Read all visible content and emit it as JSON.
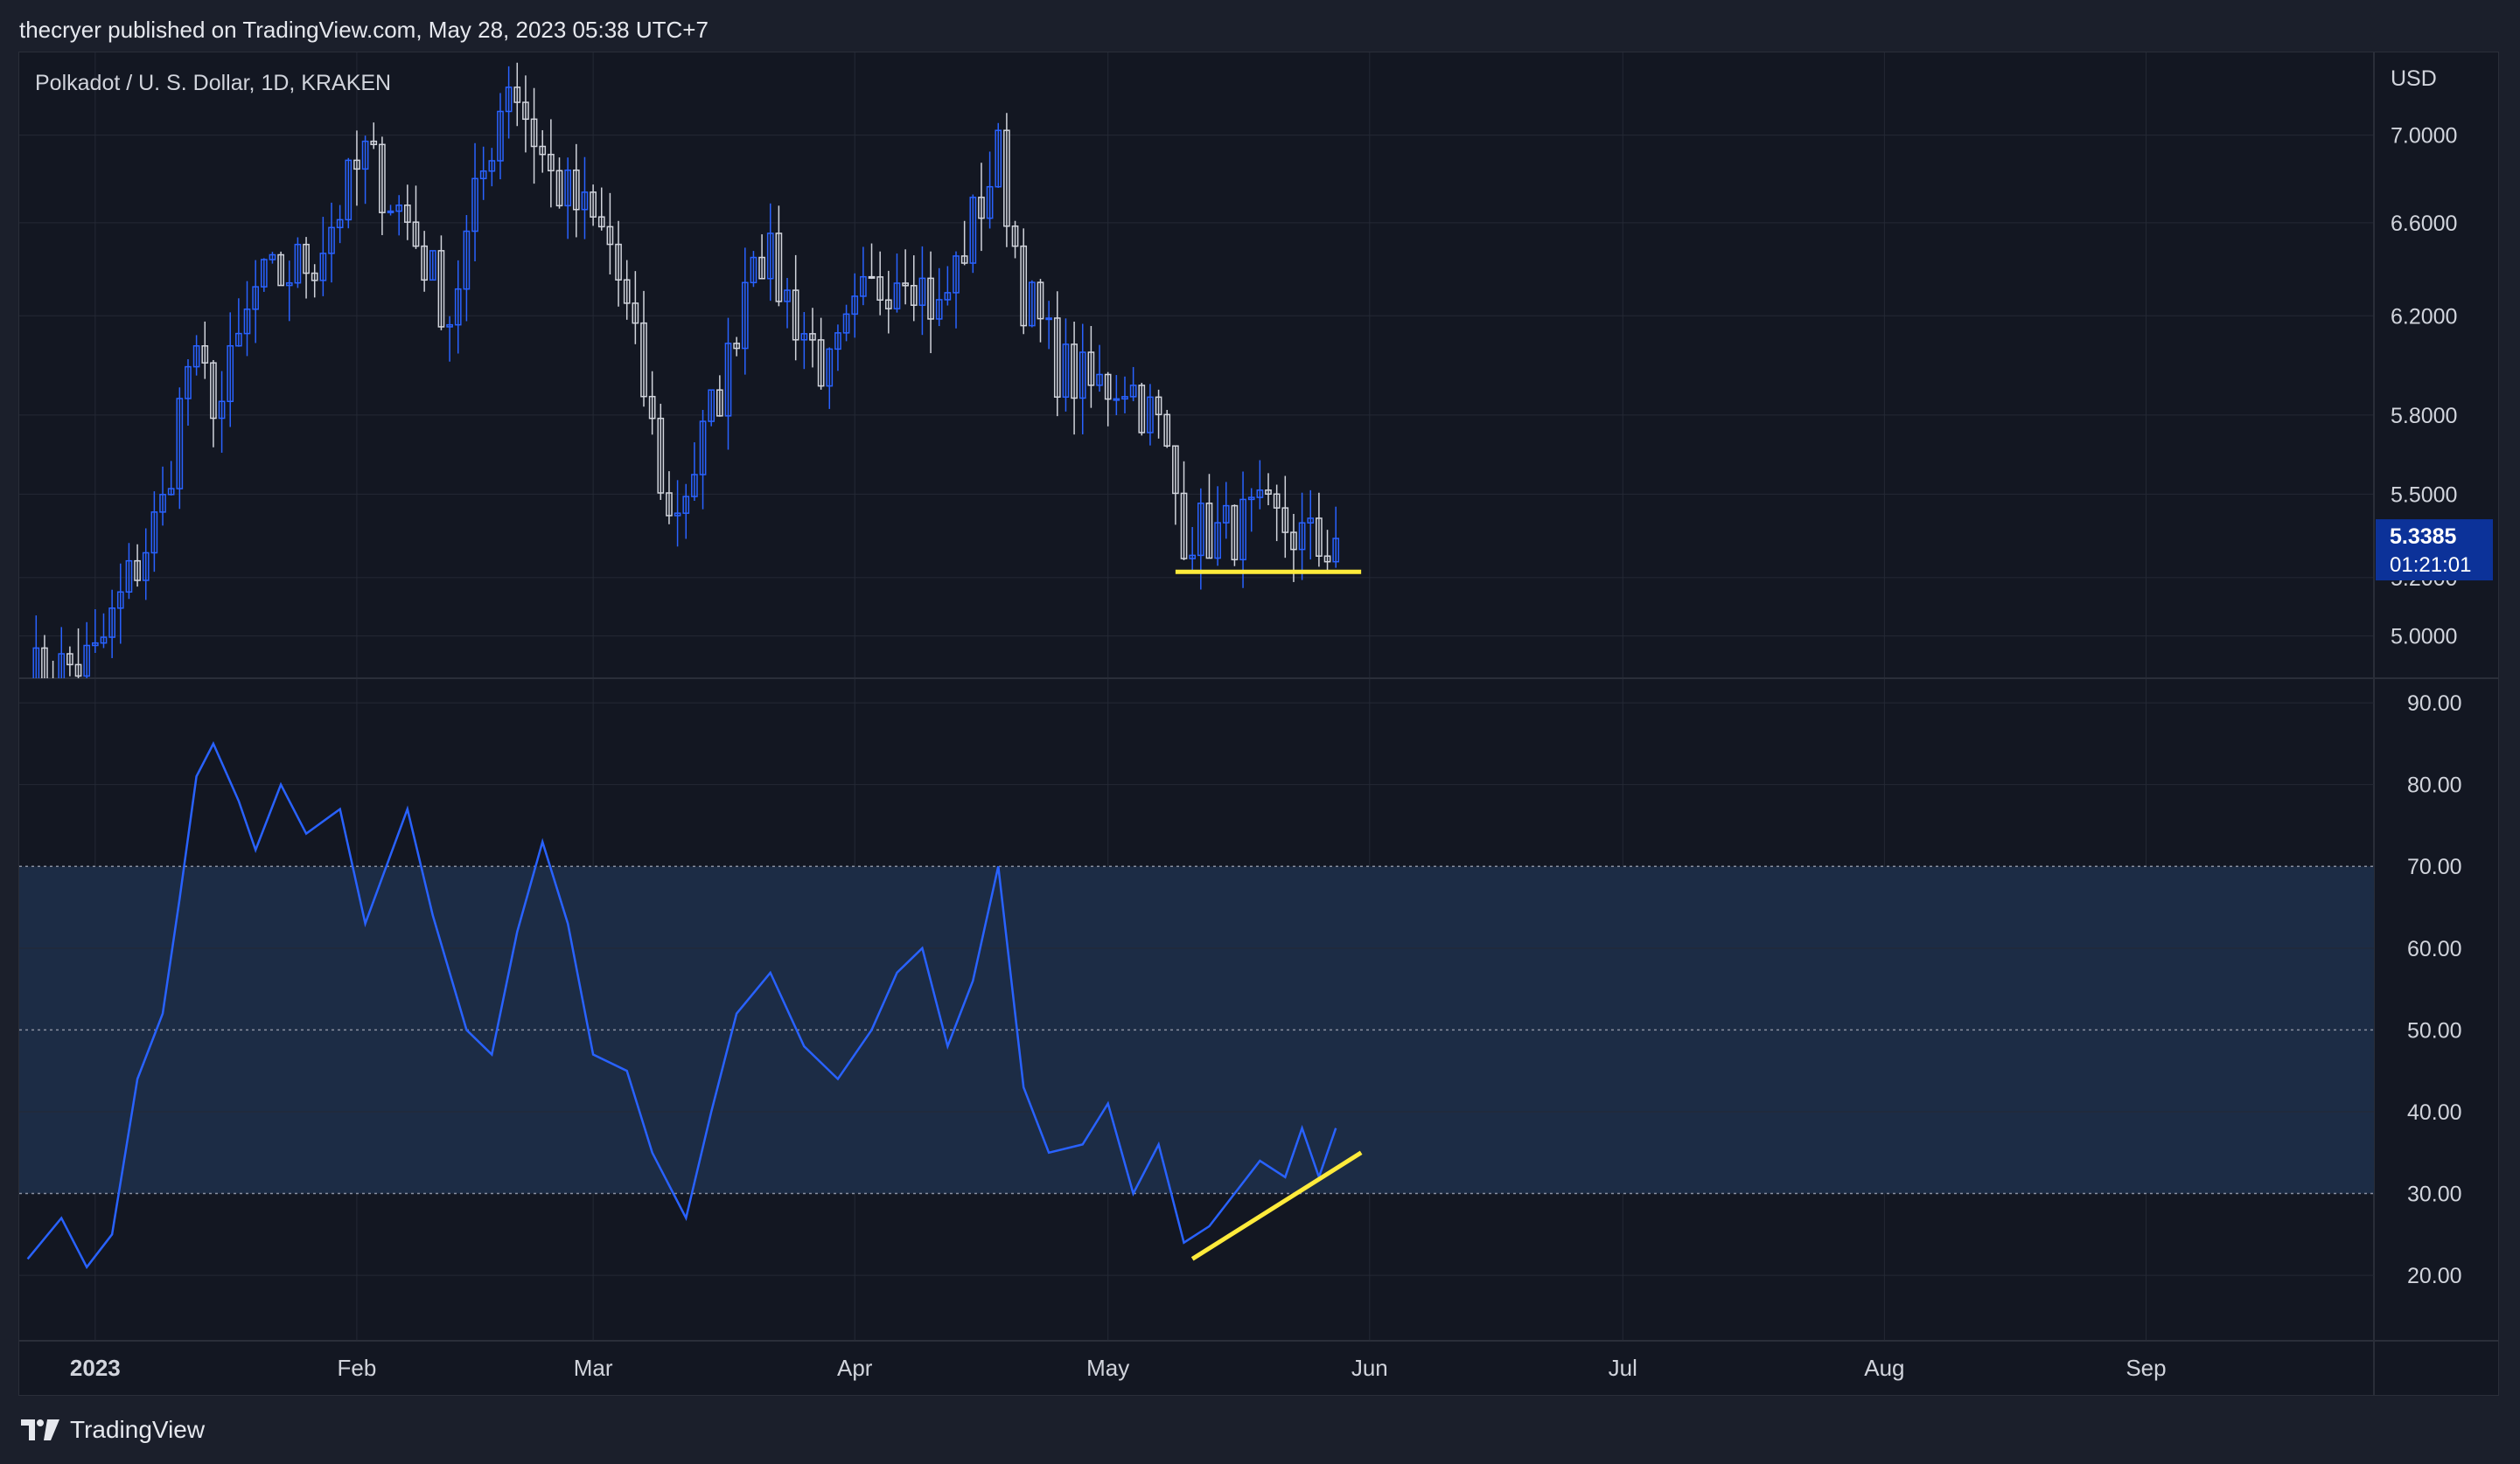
{
  "header": {
    "published": "thecryer published on TradingView.com, May 28, 2023 05:38 UTC+7"
  },
  "footer": {
    "brand": "TradingView",
    "logo_icon": "tradingview-logo-icon"
  },
  "colors": {
    "background": "#131722",
    "page": "#1b1f2b",
    "grid": "#242935",
    "text": "#d1d4dc",
    "up_candle": "#2962ff",
    "down_candle": "#d1d4dc",
    "rsi_line": "#2962ff",
    "rsi_band": "#1c2c45",
    "annotation": "#ffeb3b",
    "price_label_bg": "#0c3299"
  },
  "chart_data": [
    {
      "type": "candlestick",
      "title": "Polkadot / U. S. Dollar, 1D, KRAKEN",
      "currency_label": "USD",
      "x_tick_labels": [
        "2023",
        "Feb",
        "Mar",
        "Apr",
        "May",
        "Jun",
        "Jul",
        "Aug",
        "Sep"
      ],
      "y_ticks": [
        5.0,
        5.2,
        5.5,
        5.8,
        6.2,
        6.6,
        7.0
      ],
      "y_tick_labels": [
        "5.0000",
        "5.2000",
        "5.5000",
        "5.8000",
        "6.2000",
        "6.6000",
        "7.0000"
      ],
      "current_price": {
        "value": "5.3385",
        "countdown": "01:21:01",
        "level": 5.3385
      },
      "scale": "log",
      "grid": true,
      "approx_close_path": [
        [
          "2022-12-24",
          4.86
        ],
        [
          "2023-01-01",
          4.92
        ],
        [
          "2023-01-09",
          5.45
        ],
        [
          "2023-01-12",
          6.0
        ],
        [
          "2023-01-16",
          5.85
        ],
        [
          "2023-01-20",
          6.3
        ],
        [
          "2023-01-27",
          6.45
        ],
        [
          "2023-02-02",
          6.9
        ],
        [
          "2023-02-07",
          6.6
        ],
        [
          "2023-02-12",
          6.2
        ],
        [
          "2023-02-19",
          7.3
        ],
        [
          "2023-02-24",
          6.8
        ],
        [
          "2023-03-03",
          6.5
        ],
        [
          "2023-03-07",
          5.9
        ],
        [
          "2023-03-10",
          5.4
        ],
        [
          "2023-03-13",
          5.6
        ],
        [
          "2023-03-17",
          6.0
        ],
        [
          "2023-03-20",
          6.55
        ],
        [
          "2023-03-25",
          6.2
        ],
        [
          "2023-03-29",
          5.95
        ],
        [
          "2023-04-02",
          6.25
        ],
        [
          "2023-04-07",
          6.45
        ],
        [
          "2023-04-11",
          6.2
        ],
        [
          "2023-04-15",
          6.6
        ],
        [
          "2023-04-18",
          6.9
        ],
        [
          "2023-04-21",
          6.3
        ],
        [
          "2023-04-25",
          6.0
        ],
        [
          "2023-04-29",
          5.9
        ],
        [
          "2023-05-03",
          5.95
        ],
        [
          "2023-05-07",
          5.75
        ],
        [
          "2023-05-10",
          5.38
        ],
        [
          "2023-05-14",
          5.35
        ],
        [
          "2023-05-18",
          5.4
        ],
        [
          "2023-05-22",
          5.38
        ],
        [
          "2023-05-26",
          5.3
        ],
        [
          "2023-05-28",
          5.3385
        ]
      ],
      "annotations": [
        {
          "type": "horizontal-support",
          "from": "2023-05-09",
          "to": "2023-05-31",
          "level": 5.22,
          "color": "#ffeb3b"
        }
      ]
    },
    {
      "type": "line",
      "y_ticks": [
        20,
        30,
        40,
        50,
        60,
        70,
        80,
        90
      ],
      "y_tick_labels": [
        "20.00",
        "30.00",
        "40.00",
        "50.00",
        "60.00",
        "70.00",
        "80.00",
        "90.00"
      ],
      "band": [
        30,
        70
      ],
      "midline": 50,
      "grid": true,
      "series": [
        {
          "points": [
            [
              "2022-12-24",
              22
            ],
            [
              "2022-12-28",
              27
            ],
            [
              "2022-12-31",
              21
            ],
            [
              "2023-01-03",
              25
            ],
            [
              "2023-01-06",
              44
            ],
            [
              "2023-01-09",
              52
            ],
            [
              "2023-01-11",
              66
            ],
            [
              "2023-01-13",
              81
            ],
            [
              "2023-01-15",
              85
            ],
            [
              "2023-01-18",
              78
            ],
            [
              "2023-01-20",
              72
            ],
            [
              "2023-01-23",
              80
            ],
            [
              "2023-01-26",
              74
            ],
            [
              "2023-01-30",
              77
            ],
            [
              "2023-02-02",
              63
            ],
            [
              "2023-02-07",
              77
            ],
            [
              "2023-02-10",
              64
            ],
            [
              "2023-02-14",
              50
            ],
            [
              "2023-02-17",
              47
            ],
            [
              "2023-02-20",
              62
            ],
            [
              "2023-02-23",
              73
            ],
            [
              "2023-02-26",
              63
            ],
            [
              "2023-03-01",
              47
            ],
            [
              "2023-03-05",
              45
            ],
            [
              "2023-03-08",
              35
            ],
            [
              "2023-03-12",
              27
            ],
            [
              "2023-03-15",
              40
            ],
            [
              "2023-03-18",
              52
            ],
            [
              "2023-03-22",
              57
            ],
            [
              "2023-03-26",
              48
            ],
            [
              "2023-03-30",
              44
            ],
            [
              "2023-04-03",
              50
            ],
            [
              "2023-04-06",
              57
            ],
            [
              "2023-04-09",
              60
            ],
            [
              "2023-04-12",
              48
            ],
            [
              "2023-04-15",
              56
            ],
            [
              "2023-04-18",
              70
            ],
            [
              "2023-04-21",
              43
            ],
            [
              "2023-04-24",
              35
            ],
            [
              "2023-04-28",
              36
            ],
            [
              "2023-05-01",
              41
            ],
            [
              "2023-05-04",
              30
            ],
            [
              "2023-05-07",
              36
            ],
            [
              "2023-05-10",
              24
            ],
            [
              "2023-05-13",
              26
            ],
            [
              "2023-05-16",
              30
            ],
            [
              "2023-05-19",
              34
            ],
            [
              "2023-05-22",
              32
            ],
            [
              "2023-05-24",
              38
            ],
            [
              "2023-05-26",
              32
            ],
            [
              "2023-05-28",
              38
            ]
          ]
        }
      ],
      "annotations": [
        {
          "type": "trendline",
          "from": [
            "2023-05-11",
            22
          ],
          "to": [
            "2023-05-31",
            35
          ],
          "color": "#ffeb3b"
        }
      ]
    }
  ]
}
